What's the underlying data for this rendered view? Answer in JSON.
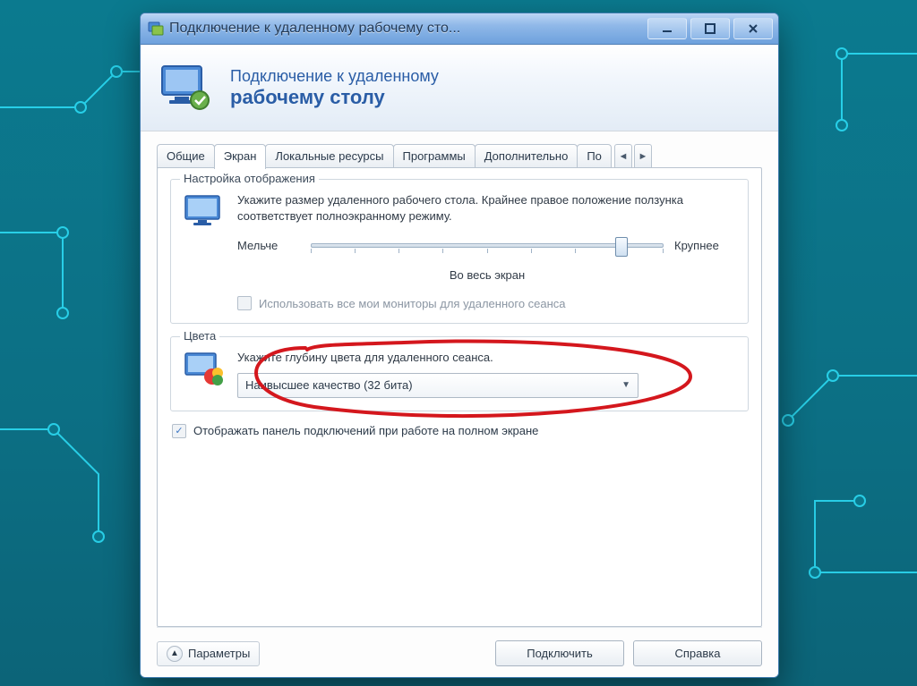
{
  "window": {
    "title": "Подключение к удаленному рабочему сто..."
  },
  "banner": {
    "line1": "Подключение к удаленному",
    "line2": "рабочему столу"
  },
  "tabs": {
    "items": [
      {
        "label": "Общие"
      },
      {
        "label": "Экран"
      },
      {
        "label": "Локальные ресурсы"
      },
      {
        "label": "Программы"
      },
      {
        "label": "Дополнительно"
      },
      {
        "label": "По"
      }
    ],
    "active_index": 1
  },
  "display_group": {
    "legend": "Настройка отображения",
    "description": "Укажите размер удаленного рабочего стола. Крайнее правое положение ползунка соответствует полноэкранному режиму.",
    "slider_min_label": "Мельче",
    "slider_max_label": "Крупнее",
    "fullscreen_label": "Во весь экран",
    "multimonitor_checkbox": "Использовать все мои мониторы для удаленного сеанса",
    "multimonitor_checked": false
  },
  "colors_group": {
    "legend": "Цвета",
    "description": "Укажите глубину цвета для удаленного сеанса.",
    "dropdown_value": "Наивысшее качество (32 бита)"
  },
  "show_bar_checkbox": {
    "label": "Отображать панель подключений при работе на полном экране",
    "checked": true
  },
  "footer": {
    "params_button": "Параметры",
    "connect_button": "Подключить",
    "help_button": "Справка"
  }
}
